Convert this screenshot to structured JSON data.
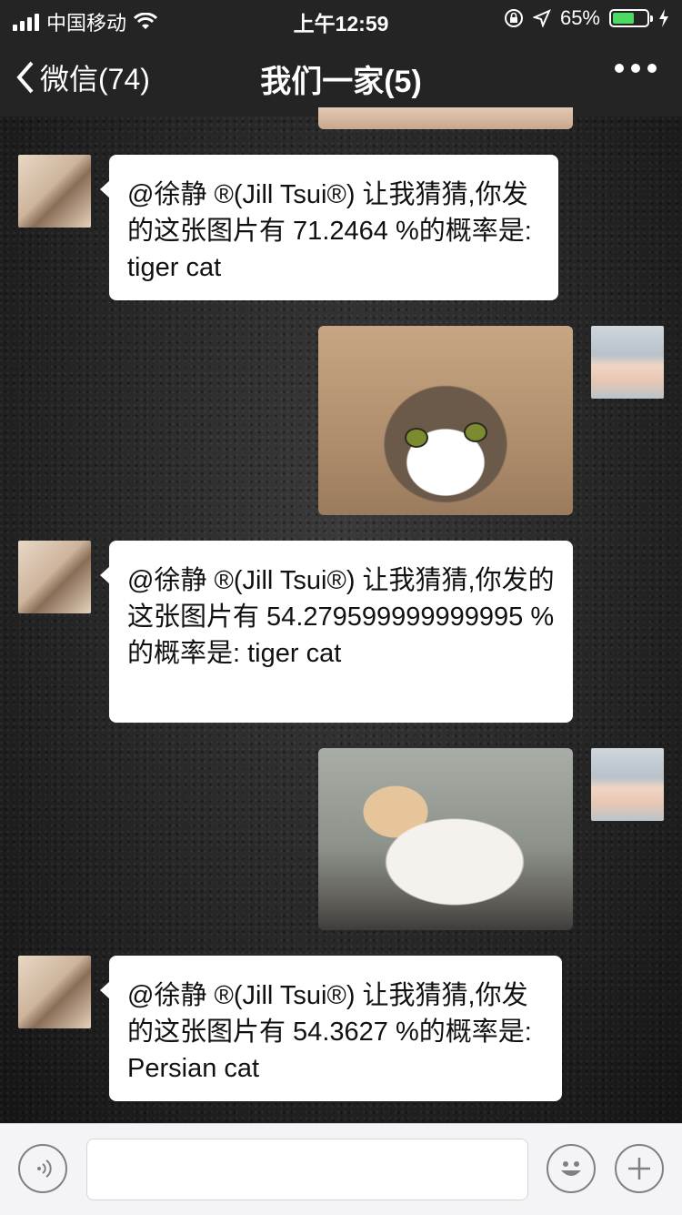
{
  "status_bar": {
    "carrier": "中国移动",
    "time": "上午12:59",
    "battery": "65%",
    "battery_level": 0.65
  },
  "nav": {
    "back_label": "微信(74)",
    "title": "我们一家(5)"
  },
  "messages": [
    {
      "type": "text",
      "from": "other",
      "text": "@徐静 ®(Jill Tsui®) 让我猜猜,你发的这张图片有 71.2464 %的概率是: tiger cat"
    },
    {
      "type": "image",
      "from": "self",
      "image": "tabby-white-cat-photo"
    },
    {
      "type": "text",
      "from": "other",
      "text": "@徐静 ®(Jill Tsui®) 让我猜猜,你发的这张图片有 54.279599999999995 %的概率是: tiger cat"
    },
    {
      "type": "image",
      "from": "self",
      "image": "orange-white-cat-photo"
    },
    {
      "type": "text",
      "from": "other",
      "text": "@徐静 ®(Jill Tsui®) 让我猜猜,你发的这张图片有 54.3627 %的概率是: Persian cat"
    }
  ],
  "input_bar": {
    "text_value": "",
    "left_icon": "voice-icon",
    "emoji_icon": "emoji-icon",
    "plus_icon": "plus-icon"
  }
}
